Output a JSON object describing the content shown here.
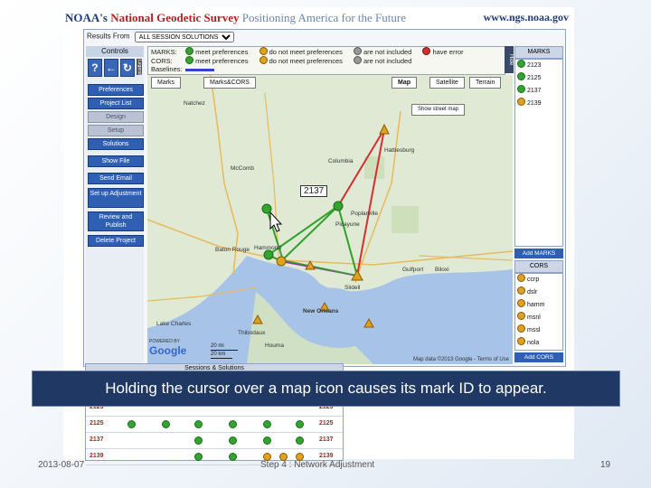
{
  "banner": {
    "org_prefix": "NOAA's",
    "org_name": "National Geodetic Survey",
    "tagline": "Positioning America for the Future",
    "url": "www.ngs.noaa.gov"
  },
  "results": {
    "label": "Results From",
    "selected": "ALL SESSION SOLUTIONS"
  },
  "controls": {
    "header": "Controls",
    "legend_tab": "Legend",
    "icons": [
      "?",
      "←",
      "↻"
    ],
    "buttons": [
      {
        "label": "Preferences",
        "enabled": true
      },
      {
        "label": "Project List",
        "enabled": true
      },
      {
        "label": "Design",
        "enabled": false
      },
      {
        "label": "Setup",
        "enabled": false
      },
      {
        "label": "Solutions",
        "enabled": true
      },
      {
        "label": "Show File",
        "enabled": true
      },
      {
        "label": "Send Email",
        "enabled": true
      },
      {
        "label": "Set up Adjustment",
        "enabled": true
      },
      {
        "label": "Review and Publish",
        "enabled": true
      },
      {
        "label": "Delete Project",
        "enabled": true
      }
    ]
  },
  "legend": {
    "marks_label": "MARKS:",
    "cors_label": "CORS:",
    "baselines_label": "Baselines:",
    "marks_items": [
      "meet preferences",
      "do not meet preferences",
      "are not included",
      "have error"
    ],
    "cors_items": [
      "meet preferences",
      "do not meet preferences",
      "are not included"
    ],
    "side_tab": "Hide"
  },
  "map": {
    "tabs": [
      "Marks",
      "Marks&CORS",
      "Map",
      "Satellite",
      "Terrain"
    ],
    "show_labels_btn": "Show street map",
    "tooltip": "2137",
    "scale_km": "20 mi",
    "scale_mi": "20 km",
    "powered_by": "POWERED BY",
    "google": "Google",
    "attribution": "Map data ©2013 Google - Terms of Use",
    "places": [
      "Natchez",
      "Columbia",
      "Hattiesburg",
      "Poplarville",
      "Baton Rouge",
      "Hammond",
      "Slidell",
      "Gulfport",
      "Biloxi",
      "New Orleans",
      "Houma",
      "Thibodaux",
      "Lake Charles",
      "Picayune",
      "McComb"
    ]
  },
  "marks_panel": {
    "header": "MARKS",
    "items": [
      "2123",
      "2125",
      "2137",
      "2139"
    ],
    "add_marks": "Add MARKS",
    "cors_header": "CORS",
    "cors_items": [
      "ccrp",
      "dslr",
      "hamm",
      "msnl",
      "mssl",
      "nola"
    ],
    "add_cors": "Add CORS"
  },
  "table": {
    "header": "Sessions & Solutions",
    "rows": [
      {
        "id": "2123",
        "dots": [
          "g",
          "g",
          "g",
          "g",
          "g",
          "g"
        ]
      },
      {
        "id": "2125",
        "dots": [
          "g",
          "g",
          "g",
          "g",
          "g",
          "g"
        ]
      },
      {
        "id": "2137",
        "dots": [
          "g",
          "g",
          "g",
          "g"
        ]
      },
      {
        "id": "2139",
        "dots": [
          "g",
          "g",
          "o",
          "o",
          "o"
        ]
      }
    ]
  },
  "caption": "Holding the cursor over a map icon causes its mark ID to appear.",
  "footer": {
    "date": "2013-08-07",
    "title": "Step 4 : Network Adjustment",
    "page": "19"
  }
}
